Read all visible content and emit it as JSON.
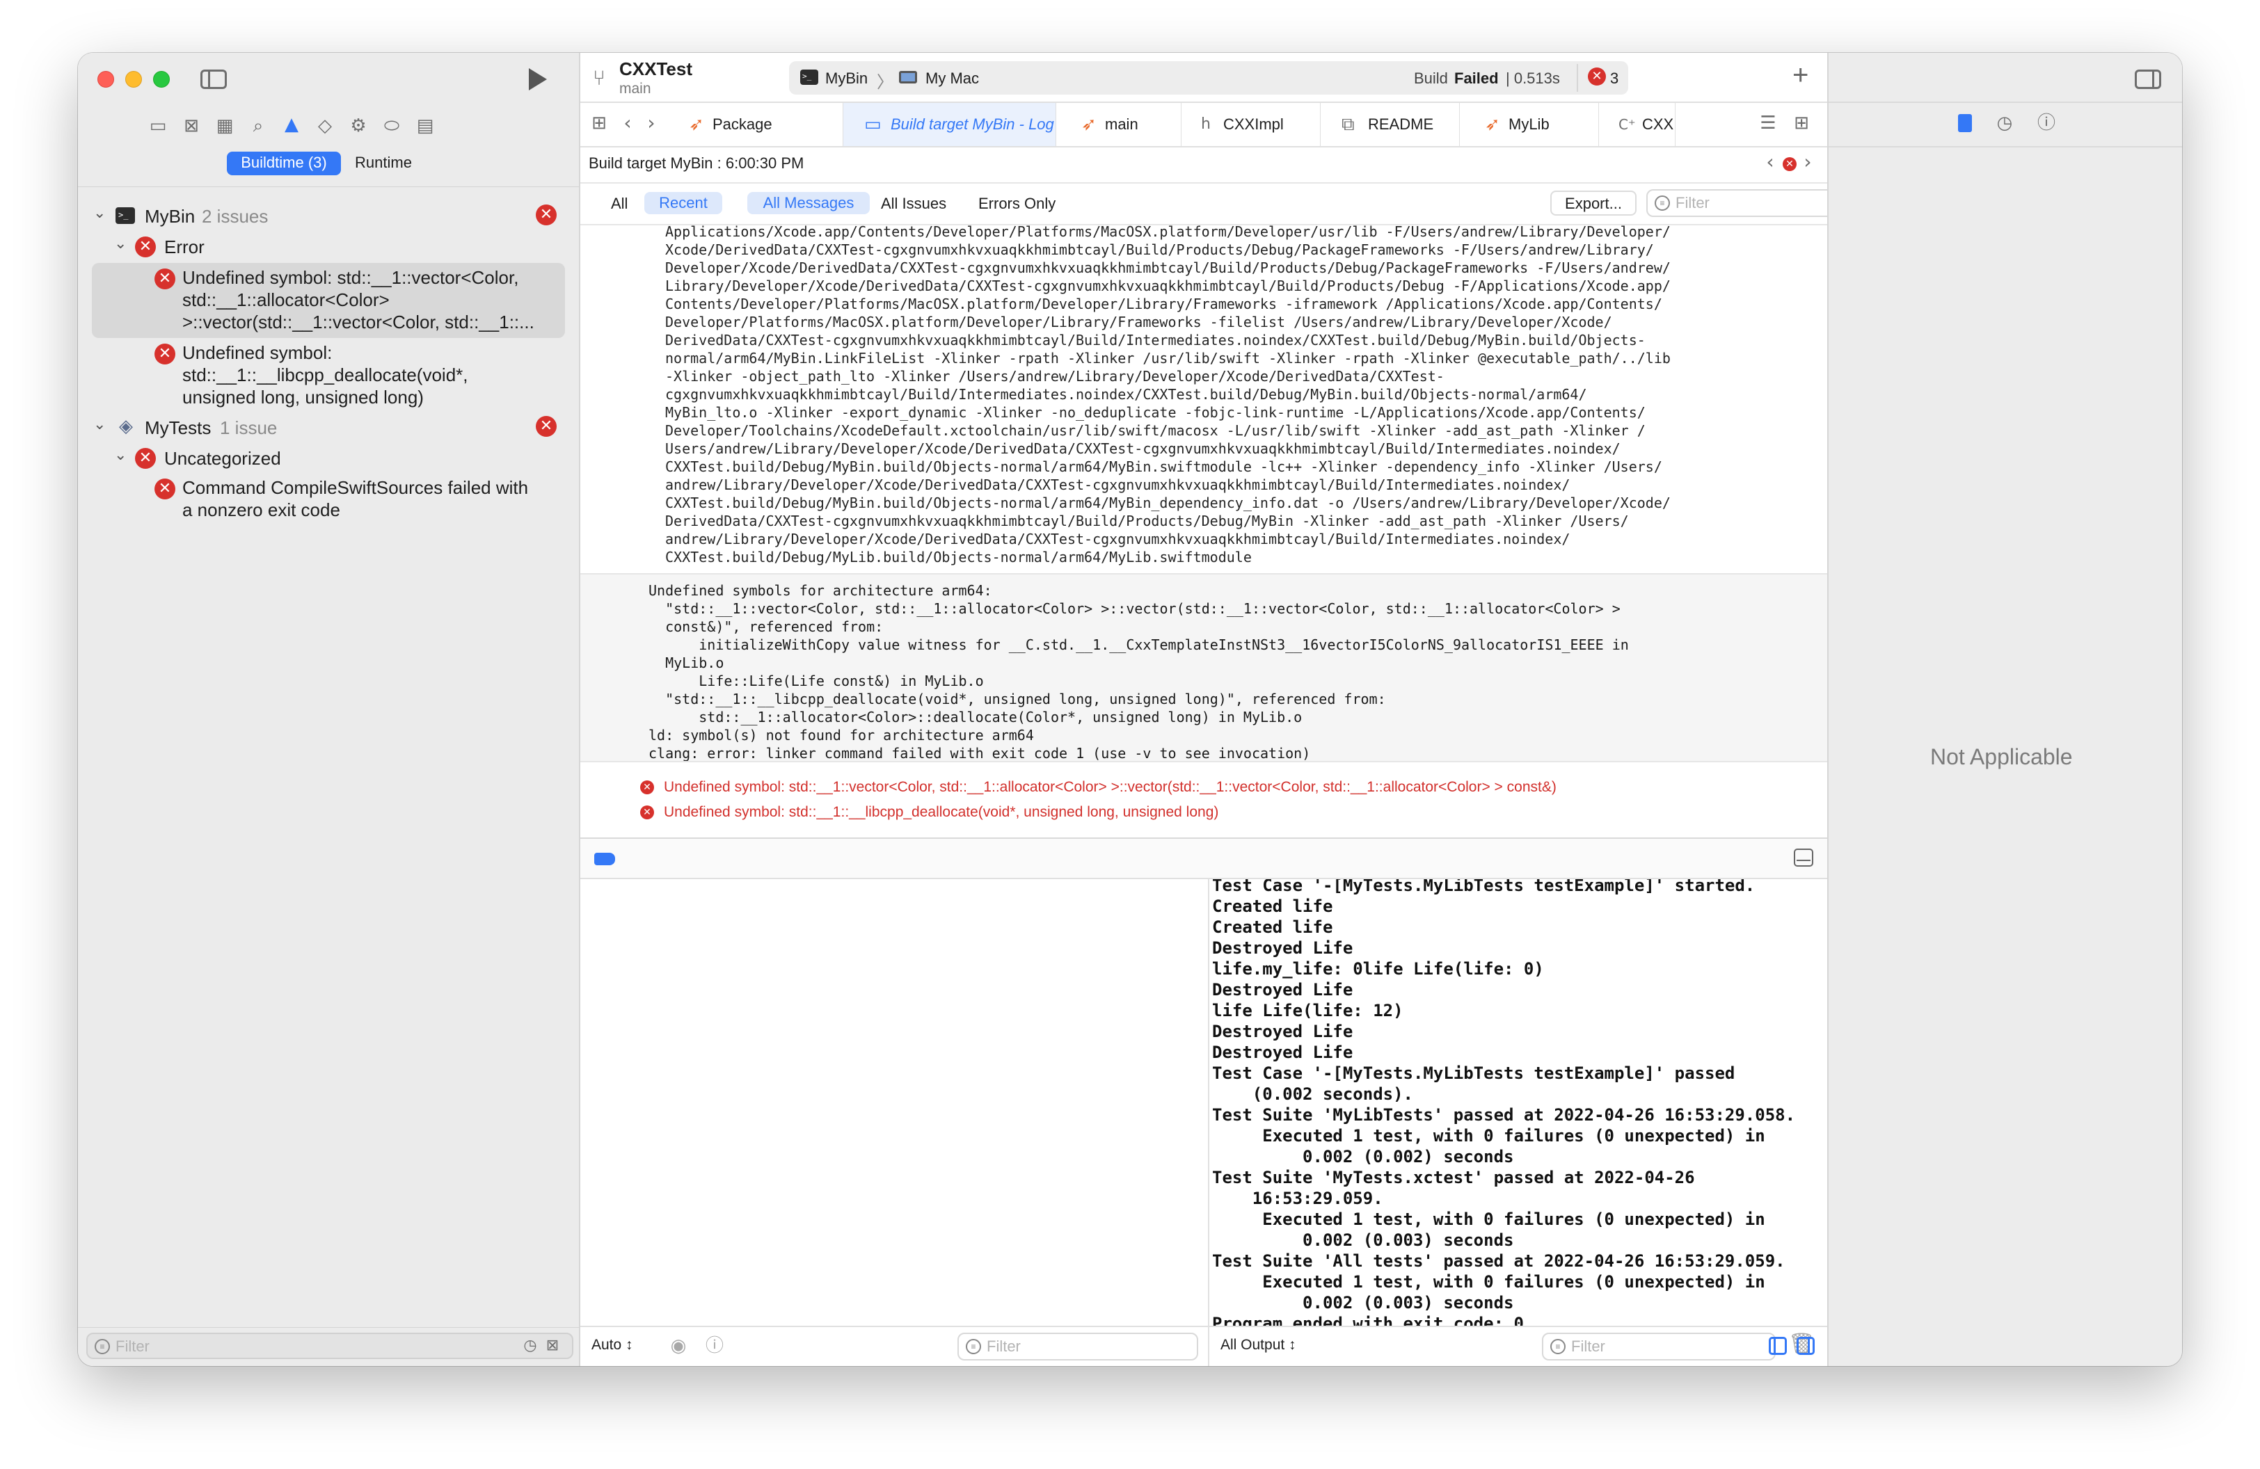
{
  "window": {
    "project_name": "CXXTest",
    "branch": "main",
    "scheme": "MyBin",
    "destination": "My Mac",
    "status_prefix": "Build ",
    "status_result": "Failed",
    "status_time": "| 0.513s",
    "error_count": "3",
    "add_label": "+"
  },
  "navigator": {
    "segments": {
      "buildtime": "Buildtime (3)",
      "runtime": "Runtime"
    },
    "groups": [
      {
        "name": "MyBin",
        "count": "2 issues"
      },
      {
        "name": "MyTests",
        "count": "1 issue"
      }
    ],
    "subgroups": {
      "error": "Error",
      "uncategorized": "Uncategorized"
    },
    "issues": [
      {
        "lines": [
          "Undefined symbol: std::__1::vector<Color,",
          "std::__1::allocator<Color>",
          ">::vector(std::__1::vector<Color, std::__1::..."
        ]
      },
      {
        "lines": [
          "Undefined symbol:",
          "std::__1::__libcpp_deallocate(void*,",
          "unsigned long, unsigned long)"
        ]
      },
      {
        "lines": [
          "Command CompileSwiftSources failed with",
          "a nonzero exit code"
        ]
      }
    ],
    "filter_placeholder": "Filter"
  },
  "tabs": [
    {
      "label": "Package"
    },
    {
      "label": "Build target MyBin - Log"
    },
    {
      "label": "main"
    },
    {
      "label": "CXXImpl"
    },
    {
      "label": "README"
    },
    {
      "label": "MyLib"
    },
    {
      "label": "CXX"
    }
  ],
  "log": {
    "title": "Build target MyBin : 6:00:30 PM",
    "filters": {
      "all": "All",
      "recent": "Recent",
      "all_messages": "All Messages",
      "all_issues": "All Issues",
      "errors_only": "Errors Only"
    },
    "export_label": "Export...",
    "filter_placeholder": "Filter",
    "command_text": "Applications/Xcode.app/Contents/Developer/Platforms/MacOSX.platform/Developer/usr/lib -F/Users/andrew/Library/Developer/\nXcode/DerivedData/CXXTest-cgxgnvumxhkvxuaqkkhmimbtcayl/Build/Products/Debug/PackageFrameworks -F/Users/andrew/Library/\nDeveloper/Xcode/DerivedData/CXXTest-cgxgnvumxhkvxuaqkkhmimbtcayl/Build/Products/Debug/PackageFrameworks -F/Users/andrew/\nLibrary/Developer/Xcode/DerivedData/CXXTest-cgxgnvumxhkvxuaqkkhmimbtcayl/Build/Products/Debug -F/Applications/Xcode.app/\nContents/Developer/Platforms/MacOSX.platform/Developer/Library/Frameworks -iframework /Applications/Xcode.app/Contents/\nDeveloper/Platforms/MacOSX.platform/Developer/Library/Frameworks -filelist /Users/andrew/Library/Developer/Xcode/\nDerivedData/CXXTest-cgxgnvumxhkvxuaqkkhmimbtcayl/Build/Intermediates.noindex/CXXTest.build/Debug/MyBin.build/Objects-\nnormal/arm64/MyBin.LinkFileList -Xlinker -rpath -Xlinker /usr/lib/swift -Xlinker -rpath -Xlinker @executable_path/../lib\n-Xlinker -object_path_lto -Xlinker /Users/andrew/Library/Developer/Xcode/DerivedData/CXXTest-\ncgxgnvumxhkvxuaqkkhmimbtcayl/Build/Intermediates.noindex/CXXTest.build/Debug/MyBin.build/Objects-normal/arm64/\nMyBin_lto.o -Xlinker -export_dynamic -Xlinker -no_deduplicate -fobjc-link-runtime -L/Applications/Xcode.app/Contents/\nDeveloper/Toolchains/XcodeDefault.xctoolchain/usr/lib/swift/macosx -L/usr/lib/swift -Xlinker -add_ast_path -Xlinker /\nUsers/andrew/Library/Developer/Xcode/DerivedData/CXXTest-cgxgnvumxhkvxuaqkkhmimbtcayl/Build/Intermediates.noindex/\nCXXTest.build/Debug/MyBin.build/Objects-normal/arm64/MyBin.swiftmodule -lc++ -Xlinker -dependency_info -Xlinker /Users/\nandrew/Library/Developer/Xcode/DerivedData/CXXTest-cgxgnvumxhkvxuaqkkhmimbtcayl/Build/Intermediates.noindex/\nCXXTest.build/Debug/MyBin.build/Objects-normal/arm64/MyBin_dependency_info.dat -o /Users/andrew/Library/Developer/Xcode/\nDerivedData/CXXTest-cgxgnvumxhkvxuaqkkhmimbtcayl/Build/Products/Debug/MyBin -Xlinker -add_ast_path -Xlinker /Users/\nandrew/Library/Developer/Xcode/DerivedData/CXXTest-cgxgnvumxhkvxuaqkkhmimbtcayl/Build/Intermediates.noindex/\nCXXTest.build/Debug/MyLib.build/Objects-normal/arm64/MyLib.swiftmodule",
    "linker_text": "Undefined symbols for architecture arm64:\n  \"std::__1::vector<Color, std::__1::allocator<Color> >::vector(std::__1::vector<Color, std::__1::allocator<Color> >\n  const&)\", referenced from:\n      initializeWithCopy value witness for __C.std.__1.__CxxTemplateInstNSt3__16vectorI5ColorNS_9allocatorIS1_EEEE in\n  MyLib.o\n      Life::Life(Life const&) in MyLib.o\n  \"std::__1::__libcpp_deallocate(void*, unsigned long, unsigned long)\", referenced from:\n      std::__1::allocator<Color>::deallocate(Color*, unsigned long) in MyLib.o\nld: symbol(s) not found for architecture arm64\nclang: error: linker command failed with exit code 1 (use -v to see invocation)",
    "errors": [
      "Undefined symbol: std::__1::vector<Color, std::__1::allocator<Color> >::vector(std::__1::vector<Color, std::__1::allocator<Color> > const&)",
      "Undefined symbol: std::__1::__libcpp_deallocate(void*, unsigned long, unsigned long)"
    ]
  },
  "debug": {
    "console_text": "Test Case '-[MyTests.MyLibTests testExample]' started.\nCreated life\nCreated life\nDestroyed Life\nlife.my_life: 0life Life(life: 0)\nDestroyed Life\nlife Life(life: 12)\nDestroyed Life\nDestroyed Life\nTest Case '-[MyTests.MyLibTests testExample]' passed\n    (0.002 seconds).\nTest Suite 'MyLibTests' passed at 2022-04-26 16:53:29.058.\n     Executed 1 test, with 0 failures (0 unexpected) in\n         0.002 (0.002) seconds\nTest Suite 'MyTests.xctest' passed at 2022-04-26\n    16:53:29.059.\n     Executed 1 test, with 0 failures (0 unexpected) in\n         0.002 (0.003) seconds\nTest Suite 'All tests' passed at 2022-04-26 16:53:29.059.\n     Executed 1 test, with 0 failures (0 unexpected) in\n         0.002 (0.003) seconds\nProgram ended with exit code: 0",
    "variables_mode": "Auto ↕",
    "output_mode": "All Output ↕",
    "filter_placeholder": "Filter"
  },
  "inspector": {
    "not_applicable": "Not Applicable"
  },
  "colors": {
    "accent": "#3478f6",
    "error": "#d7312c",
    "error_text": "#d2302c"
  }
}
